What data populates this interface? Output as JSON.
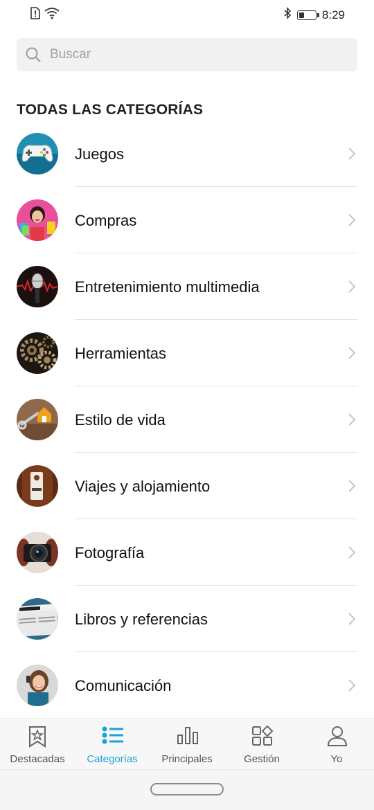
{
  "status_bar": {
    "time": "8:29",
    "battery_level": 0.3,
    "icons": [
      "alert-sim-icon",
      "wifi-icon",
      "bluetooth-icon",
      "battery-icon"
    ]
  },
  "search": {
    "placeholder": "Buscar"
  },
  "section_title": "TODAS LAS CATEGORÍAS",
  "categories": [
    {
      "label": "Juegos",
      "icon": "gamepad-icon"
    },
    {
      "label": "Compras",
      "icon": "shopping-icon"
    },
    {
      "label": "Entretenimiento multimedia",
      "icon": "microphone-icon"
    },
    {
      "label": "Herramientas",
      "icon": "gears-icon"
    },
    {
      "label": "Estilo de vida",
      "icon": "house-key-icon"
    },
    {
      "label": "Viajes y alojamiento",
      "icon": "door-sign-icon"
    },
    {
      "label": "Fotografía",
      "icon": "camera-icon"
    },
    {
      "label": "Libros y referencias",
      "icon": "newspaper-icon"
    },
    {
      "label": "Comunicación",
      "icon": "phone-call-icon"
    }
  ],
  "bottom_nav": [
    {
      "label": "Destacadas",
      "icon": "star-bookmark-icon",
      "active": false
    },
    {
      "label": "Categorías",
      "icon": "list-icon",
      "active": true
    },
    {
      "label": "Principales",
      "icon": "bar-chart-icon",
      "active": false
    },
    {
      "label": "Gestión",
      "icon": "apps-grid-icon",
      "active": false
    },
    {
      "label": "Yo",
      "icon": "person-icon",
      "active": false
    }
  ],
  "colors": {
    "accent": "#1aa3d9",
    "text": "#111111",
    "muted": "#555555"
  }
}
